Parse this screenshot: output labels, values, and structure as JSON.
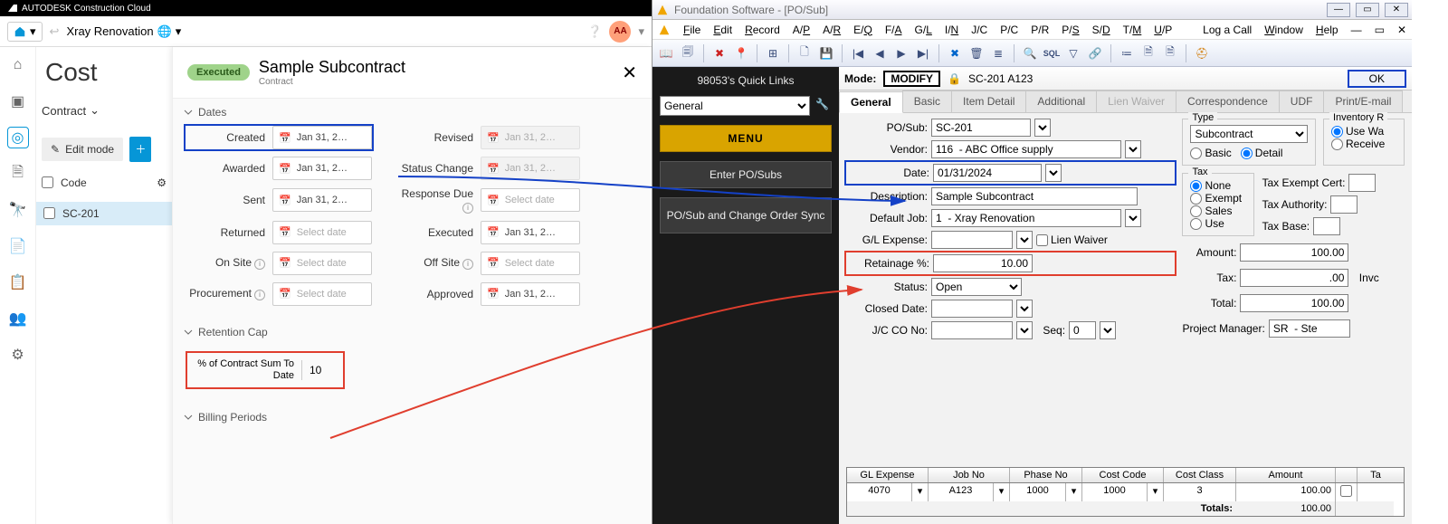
{
  "autodesk": {
    "brand": "AUTODESK Construction Cloud",
    "project": "Xray Renovation",
    "avatar": "AA",
    "page_title": "Cost",
    "contract_label": "Contract",
    "edit_mode": "Edit mode",
    "code_label": "Code",
    "row_code": "SC-201",
    "detail": {
      "status_badge": "Executed",
      "title": "Sample Subcontract",
      "subtitle": "Contract",
      "sections": {
        "dates": "Dates",
        "retention": "Retention Cap",
        "billing": "Billing Periods"
      },
      "dates": {
        "created": {
          "label": "Created",
          "value": "Jan 31, 2…"
        },
        "revised": {
          "label": "Revised",
          "value": "Jan 31, 2…"
        },
        "awarded": {
          "label": "Awarded",
          "value": "Jan 31, 2…"
        },
        "status_change": {
          "label": "Status Change",
          "value": "Jan 31, 2…"
        },
        "sent": {
          "label": "Sent",
          "value": "Jan 31, 2…"
        },
        "response_due": {
          "label": "Response Due",
          "value": "Select date"
        },
        "returned": {
          "label": "Returned",
          "value": "Select date"
        },
        "executed": {
          "label": "Executed",
          "value": "Jan 31, 2…"
        },
        "on_site": {
          "label": "On Site",
          "value": "Select date"
        },
        "off_site": {
          "label": "Off Site",
          "value": "Select date"
        },
        "procurement": {
          "label": "Procurement",
          "value": "Select date"
        },
        "approved": {
          "label": "Approved",
          "value": "Jan 31, 2…"
        }
      },
      "retention": {
        "label": "% of Contract Sum To Date",
        "value": "10"
      }
    }
  },
  "foundation": {
    "window_title": "Foundation Software - [PO/Sub]",
    "menu": [
      "File",
      "Edit",
      "Record",
      "A/P",
      "A/R",
      "E/Q",
      "F/A",
      "G/L",
      "I/N",
      "J/C",
      "P/C",
      "P/R",
      "P/S",
      "S/D",
      "T/M",
      "U/P",
      "Log a Call",
      "Window",
      "Help"
    ],
    "quick_links": {
      "title": "98053's Quick Links",
      "select": "General",
      "menu": "MENU",
      "enter": "Enter PO/Subs",
      "sync": "PO/Sub and Change Order Sync"
    },
    "mode": {
      "label": "Mode:",
      "value": "MODIFY",
      "doc": "SC-201  A123",
      "ok": "OK"
    },
    "tabs": [
      "General",
      "Basic",
      "Item Detail",
      "Additional",
      "Lien Waiver",
      "Correspondence",
      "UDF",
      "Print/E-mail"
    ],
    "form": {
      "posub": {
        "label": "PO/Sub:",
        "value": "SC-201"
      },
      "vendor": {
        "label": "Vendor:",
        "value": "116  - ABC Office supply"
      },
      "date": {
        "label": "Date:",
        "value": "01/31/2024"
      },
      "description": {
        "label": "Description:",
        "value": "Sample Subcontract"
      },
      "default_job": {
        "label": "Default Job:",
        "value": "1  - Xray Renovation"
      },
      "gl_expense": {
        "label": "G/L Expense:",
        "value": ""
      },
      "lien": "Lien Waiver",
      "retainage": {
        "label": "Retainage %:",
        "value": "10.00"
      },
      "status": {
        "label": "Status:",
        "value": "Open"
      },
      "closed": {
        "label": "Closed Date:",
        "value": ""
      },
      "jcco": {
        "label": "J/C CO No:",
        "value": ""
      },
      "seq": {
        "label": "Seq:",
        "value": "0"
      },
      "type_box": {
        "title": "Type",
        "value": "Subcontract",
        "basic": "Basic",
        "detail": "Detail"
      },
      "inventory": {
        "title": "Inventory R",
        "usewa": "Use Wa",
        "receive": "Receive"
      },
      "tax_box": {
        "title": "Tax",
        "none": "None",
        "exempt": "Exempt",
        "sales": "Sales",
        "use": "Use"
      },
      "exempt_cert": "Tax Exempt Cert:",
      "tax_authority": "Tax Authority:",
      "tax_base": "Tax Base:",
      "amount": {
        "label": "Amount:",
        "value": "100.00"
      },
      "tax": {
        "label": "Tax:",
        "value": ".00"
      },
      "total": {
        "label": "Total:",
        "value": "100.00"
      },
      "invc": "Invc",
      "pm": {
        "label": "Project Manager:",
        "value": "SR  - Ste"
      }
    },
    "grid": {
      "headers": [
        "GL Expense",
        "Job No",
        "Phase No",
        "Cost Code",
        "Cost Class",
        "Amount",
        "",
        "Ta"
      ],
      "row": [
        "4070",
        "A123",
        "1000",
        "1000",
        "3",
        "100.00",
        "",
        ""
      ],
      "totals": {
        "label": "Totals:",
        "value": "100.00"
      }
    }
  }
}
